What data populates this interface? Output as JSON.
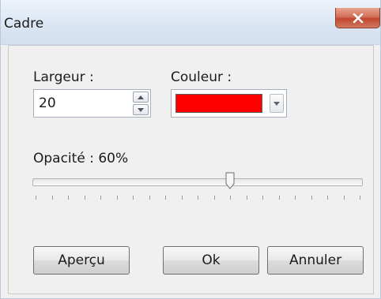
{
  "window": {
    "title": "Cadre"
  },
  "fields": {
    "width_label": "Largeur :",
    "width_value": "20",
    "color_label": "Couleur :",
    "color_value": "#ff0000",
    "opacity_label": "Opacité : 60%",
    "opacity_value": 60
  },
  "buttons": {
    "preview": "Aperçu",
    "ok": "Ok",
    "cancel": "Annuler"
  },
  "icons": {
    "close": "close-icon",
    "spin_up": "arrow-up-icon",
    "spin_down": "arrow-down-icon",
    "dropdown": "chevron-down-icon"
  }
}
